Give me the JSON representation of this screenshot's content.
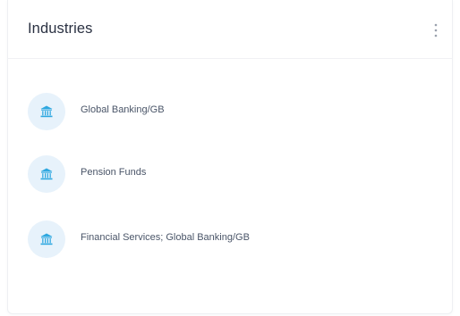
{
  "card": {
    "title": "Industries",
    "menu_icon": "more-vertical-icon"
  },
  "industries": [
    {
      "label": "Global Banking/GB",
      "icon": "bank-icon"
    },
    {
      "label": "Pension Funds",
      "icon": "bank-icon"
    },
    {
      "label": "Financial Services; Global Banking/GB",
      "icon": "bank-icon"
    }
  ],
  "colors": {
    "icon_color": "#2fa8e0",
    "icon_bg": "#e7f2fb",
    "title": "#2a3142",
    "label": "#4a5568"
  }
}
